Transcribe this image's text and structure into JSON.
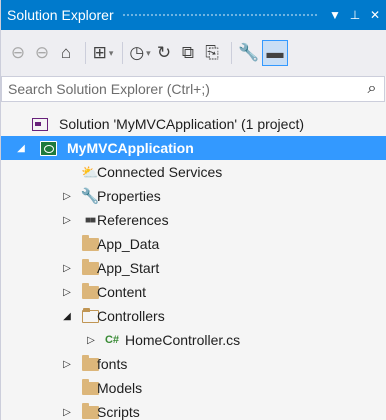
{
  "window": {
    "title": "Solution Explorer",
    "buttons": {
      "dropdown": "▼",
      "pin": "⊥",
      "close": "✕"
    }
  },
  "toolbar": {
    "items": [
      {
        "name": "back-icon",
        "glyph": "⊖",
        "disabled": true
      },
      {
        "name": "forward-icon",
        "glyph": "⊖",
        "disabled": true
      },
      {
        "name": "home-icon",
        "glyph": "⌂",
        "disabled": false
      },
      {
        "name": "switch-views-icon",
        "glyph": "⊞",
        "disabled": false,
        "dropdown": true
      },
      {
        "name": "pending-changes-filter-icon",
        "glyph": "◷",
        "disabled": false,
        "dropdown": true
      },
      {
        "name": "sync-icon",
        "glyph": "↻",
        "disabled": false
      },
      {
        "name": "collapse-all-icon",
        "glyph": "⧉",
        "disabled": false
      },
      {
        "name": "show-all-files-icon",
        "glyph": "⎘",
        "disabled": false
      },
      {
        "name": "properties-wrench-icon",
        "glyph": "🔧",
        "disabled": false
      },
      {
        "name": "preview-selected-icon",
        "glyph": "▬",
        "disabled": false,
        "active": true
      }
    ],
    "dropdown_glyph": "▾"
  },
  "search": {
    "placeholder": "Search Solution Explorer (Ctrl+;)",
    "icon": "search-icon"
  },
  "tree": {
    "items": [
      {
        "label": "Solution 'MyMVCApplication' (1 project)",
        "icon": "solution-icon",
        "level": 0,
        "expander": ""
      },
      {
        "label": "MyMVCApplication",
        "icon": "web-project-icon",
        "level": 0,
        "expander": "◢",
        "selected": true
      },
      {
        "label": "Connected Services",
        "icon": "connected-services-icon",
        "level": 1,
        "expander": ""
      },
      {
        "label": "Properties",
        "icon": "wrench-icon",
        "level": 1,
        "expander": "▷"
      },
      {
        "label": "References",
        "icon": "references-icon",
        "level": 1,
        "expander": "▷"
      },
      {
        "label": "App_Data",
        "icon": "folder-icon",
        "level": 1,
        "expander": ""
      },
      {
        "label": "App_Start",
        "icon": "folder-icon",
        "level": 1,
        "expander": "▷"
      },
      {
        "label": "Content",
        "icon": "folder-icon",
        "level": 1,
        "expander": "▷"
      },
      {
        "label": "Controllers",
        "icon": "open-folder-icon",
        "level": 1,
        "expander": "◢"
      },
      {
        "label": "HomeController.cs",
        "icon": "csharp-file-icon",
        "level": 2,
        "expander": "▷"
      },
      {
        "label": "fonts",
        "icon": "folder-icon",
        "level": 1,
        "expander": "▷"
      },
      {
        "label": "Models",
        "icon": "folder-icon",
        "level": 1,
        "expander": ""
      },
      {
        "label": "Scripts",
        "icon": "folder-icon",
        "level": 1,
        "expander": "▷"
      }
    ]
  },
  "glyphs": {
    "csharp": "C#",
    "wrench": "🔧",
    "refs": "■■",
    "cloud": "⛅",
    "search": "⌕"
  },
  "colors": {
    "titlebar": "#007acc",
    "selection": "#3399ff",
    "folder": "#dcb67a",
    "background": "#f5f5f5"
  }
}
